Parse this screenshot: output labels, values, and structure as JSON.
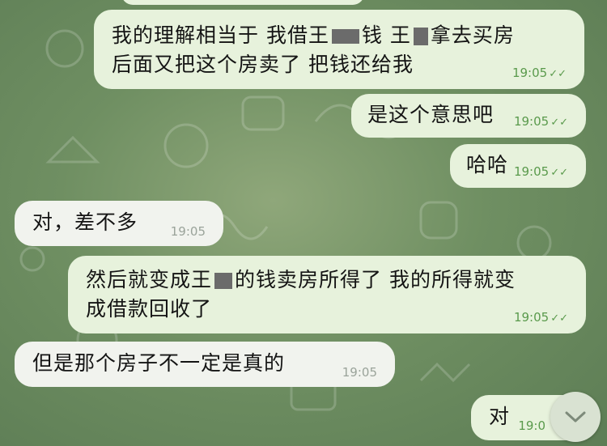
{
  "messages": [
    {
      "id": "m1",
      "direction": "outgoing",
      "lines": [
        "我的理解相当于 我借王",
        "钱 王",
        "拿去买房",
        "后面又把这个房卖了 把钱还给我"
      ],
      "time": "19:05",
      "status": "read"
    },
    {
      "id": "m2",
      "direction": "outgoing",
      "text": "是这个意思吧",
      "time": "19:05",
      "status": "read"
    },
    {
      "id": "m3",
      "direction": "outgoing",
      "text": "哈哈",
      "time": "19:05",
      "status": "read"
    },
    {
      "id": "m4",
      "direction": "incoming",
      "text": "对，差不多",
      "time": "19:05"
    },
    {
      "id": "m5",
      "direction": "outgoing",
      "lines": [
        "然后就变成王",
        "的钱卖房所得了 我的所得就变",
        "成借款回收了"
      ],
      "time": "19:05",
      "status": "read"
    },
    {
      "id": "m6",
      "direction": "incoming",
      "text": "但是那个房子不一定是真的",
      "time": "19:05"
    },
    {
      "id": "m7",
      "direction": "outgoing",
      "text": "对",
      "time": "19:0"
    }
  ],
  "icons": {
    "read_receipt": "double-check-icon",
    "scroll_down": "chevron-down-icon"
  },
  "colors": {
    "outgoing_bubble": "#e7f2dc",
    "incoming_bubble": "#f1f3ee",
    "wallpaper": "#6f8f62",
    "read_tick": "#5a9a4c"
  }
}
